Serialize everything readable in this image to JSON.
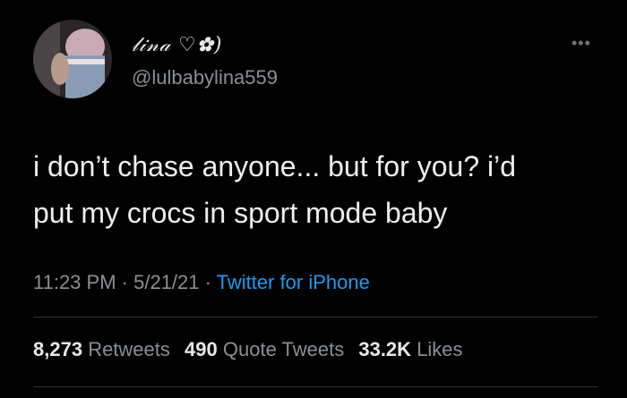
{
  "tweet": {
    "display_name": "𝓁𝒾𝓃𝒶 ♡✿)",
    "handle": "@lulbabylina559",
    "more_icon": "•••",
    "text_line1": "i don’t chase anyone... but for you? i’d",
    "text_line2": "put my crocs in sport mode baby",
    "time": "11:23 PM",
    "sep1": " · ",
    "date": "5/21/21",
    "sep2": " · ",
    "source": "Twitter for iPhone"
  },
  "stats": {
    "retweets_count": "8,273",
    "retweets_label": "Retweets",
    "quotes_count": "490",
    "quotes_label": "Quote Tweets",
    "likes_count": "33.2K",
    "likes_label": "Likes"
  },
  "colors": {
    "background": "#000000",
    "text": "#e7e9ea",
    "muted": "#8b8f94",
    "link": "#1d9bf0"
  }
}
